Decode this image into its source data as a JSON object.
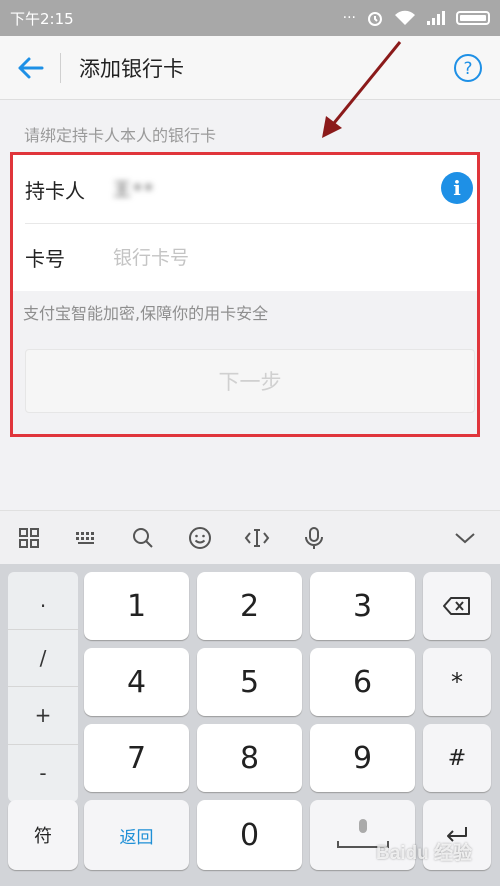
{
  "status_bar": {
    "time": "下午2:15",
    "dots": "···"
  },
  "header": {
    "title": "添加银行卡"
  },
  "form": {
    "hint": "请绑定持卡人本人的银行卡",
    "holder_label": "持卡人",
    "holder_value": "王**",
    "card_label": "卡号",
    "card_placeholder": "银行卡号",
    "security_note": "支付宝智能加密,保障你的用卡安全",
    "next_label": "下一步"
  },
  "keyboard": {
    "symbols": [
      ".",
      "/",
      "+",
      "-"
    ],
    "keys": [
      "1",
      "2",
      "3",
      "4",
      "5",
      "6",
      "7",
      "8",
      "9"
    ],
    "multiply_label": "*",
    "hash_label": "#",
    "symbol_switch_label": "符",
    "return_label": "返回",
    "zero_label": "0"
  },
  "watermark": "Baidu 经验",
  "colors": {
    "accent": "#1e90e6",
    "highlight": "#e0353b",
    "arrow": "#8b1a1a"
  }
}
